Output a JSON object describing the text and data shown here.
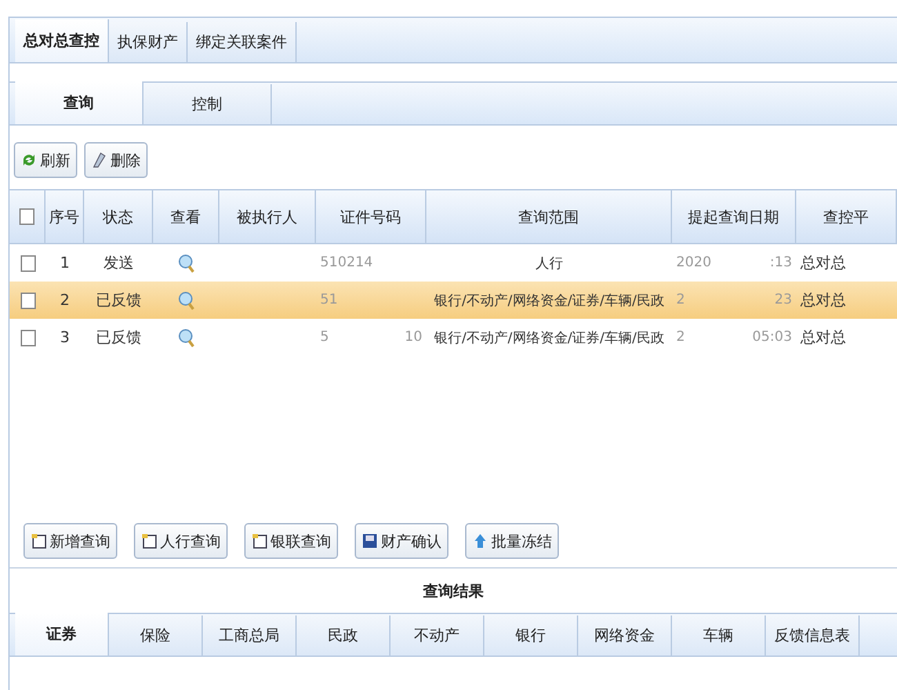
{
  "top_tabs": [
    {
      "label": "总对总查控",
      "selected": true
    },
    {
      "label": "执保财产",
      "selected": false
    },
    {
      "label": "绑定关联案件",
      "selected": false
    }
  ],
  "sub_tabs": [
    {
      "label": "查询",
      "selected": true
    },
    {
      "label": "控制",
      "selected": false
    }
  ],
  "toolbar": [
    {
      "label": "刷新",
      "kind": "refresh"
    },
    {
      "label": "删除",
      "kind": "erase"
    }
  ],
  "table": {
    "all_checked": false,
    "columns": [
      "序号",
      "状态",
      "查看",
      "被执行人",
      "证件号码",
      "查询范围",
      "提起查询日期",
      "查控平"
    ],
    "rows": [
      {
        "checked": false,
        "selected": false,
        "no": "1",
        "status": "发送",
        "id_start": "510214",
        "id_end": "",
        "scope": "人行",
        "date_start": "2020",
        "date_end": ":13",
        "platform": "总对总"
      },
      {
        "checked": false,
        "selected": true,
        "no": "2",
        "status": "已反馈",
        "id_start": "51",
        "id_end": "",
        "scope": "银行/不动产/网络资金/证券/车辆/民政",
        "date_start": "2",
        "date_end": "23",
        "platform": "总对总"
      },
      {
        "checked": false,
        "selected": false,
        "no": "3",
        "status": "已反馈",
        "id_start": "5",
        "id_end": "10",
        "scope": "银行/不动产/网络资金/证券/车辆/民政",
        "date_start": "2",
        "date_end": "05:03",
        "platform": "总对总"
      }
    ]
  },
  "actions": [
    {
      "label": "新增查询",
      "kind": "doc"
    },
    {
      "label": "人行查询",
      "kind": "doc"
    },
    {
      "label": "银联查询",
      "kind": "doc"
    },
    {
      "label": "财产确认",
      "kind": "save"
    },
    {
      "label": "批量冻结",
      "kind": "up"
    }
  ],
  "results": {
    "title": "查询结果",
    "tabs": [
      {
        "label": "证券",
        "selected": true
      },
      {
        "label": "保险",
        "selected": false
      },
      {
        "label": "工商总局",
        "selected": false
      },
      {
        "label": "民政",
        "selected": false
      },
      {
        "label": "不动产",
        "selected": false
      },
      {
        "label": "银行",
        "selected": false
      },
      {
        "label": "网络资金",
        "selected": false
      },
      {
        "label": "车辆",
        "selected": false
      },
      {
        "label": "反馈信息表",
        "selected": false
      }
    ]
  }
}
